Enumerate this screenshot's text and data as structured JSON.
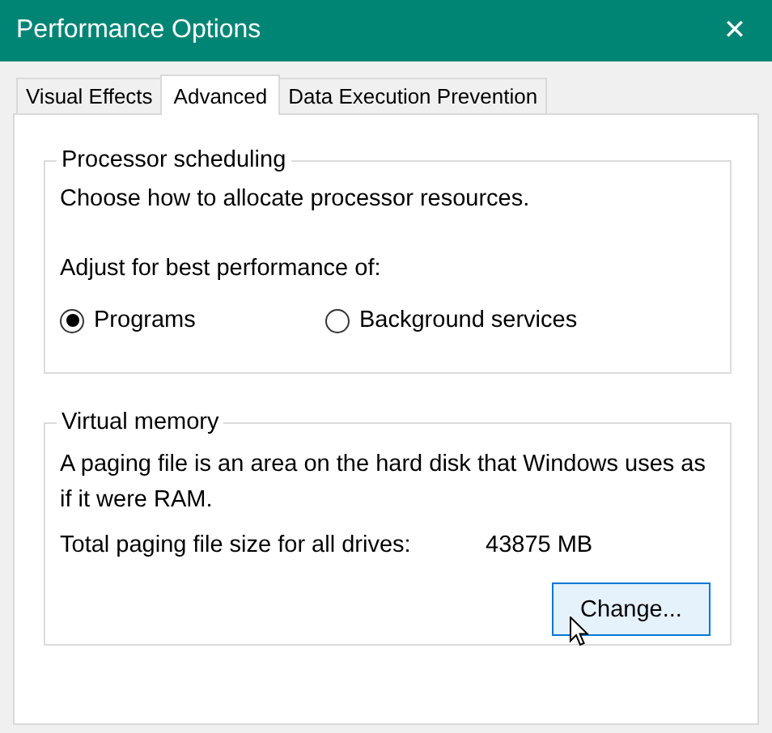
{
  "window": {
    "title": "Performance Options",
    "close": "✕"
  },
  "tabs": [
    {
      "label": "Visual Effects",
      "selected": false
    },
    {
      "label": "Advanced",
      "selected": true
    },
    {
      "label": "Data Execution Prevention",
      "selected": false
    }
  ],
  "processor_scheduling": {
    "title": "Processor scheduling",
    "description": "Choose how to allocate processor resources.",
    "adjust_label": "Adjust for best performance of:",
    "options": [
      {
        "label": "Programs",
        "selected": true
      },
      {
        "label": "Background services",
        "selected": false
      }
    ]
  },
  "virtual_memory": {
    "title": "Virtual memory",
    "description": "A paging file is an area on the hard disk that Windows uses as if it were RAM.",
    "total_label": "Total paging file size for all drives:",
    "total_value": "43875 MB",
    "button": {
      "label": "Change...",
      "hovered": true
    }
  }
}
